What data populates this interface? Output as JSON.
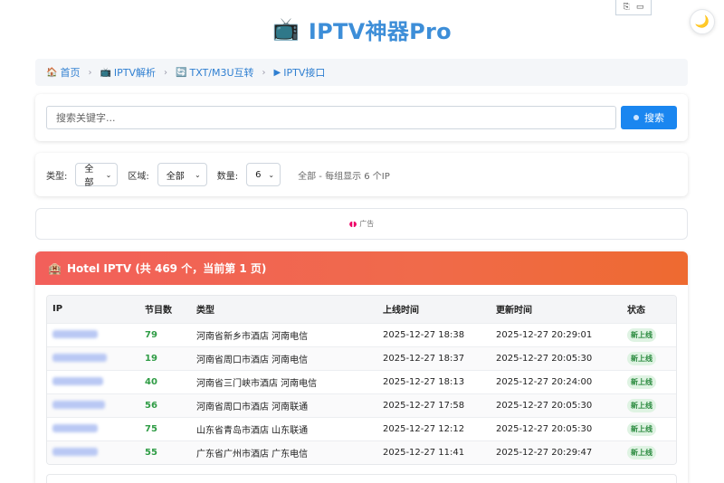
{
  "app": {
    "title": "IPTV神器Pro",
    "title_icon": "tv-icon",
    "brand_color": "#3d8ed8"
  },
  "top_icons": [
    "clipboard-icon",
    "monitor-icon"
  ],
  "theme_toggle": {
    "icon": "moon-icon",
    "glyph": "🌙"
  },
  "breadcrumb": [
    {
      "icon": "🏠",
      "icon_name": "home-icon",
      "label": "首页"
    },
    {
      "icon": "📺",
      "icon_name": "tv-icon",
      "label": "IPTV解析"
    },
    {
      "icon": "🔄",
      "icon_name": "convert-icon",
      "label": "TXT/M3U互转"
    },
    {
      "icon": "▶",
      "icon_name": "play-icon",
      "label": "IPTV接口"
    }
  ],
  "search": {
    "placeholder": "搜索关键字...",
    "button_label": "搜索",
    "button_color": "#1a86f0"
  },
  "filters": {
    "type_label": "类型:",
    "type_value": "全部",
    "region_label": "区域:",
    "region_value": "全部",
    "count_label": "数量:",
    "count_value": "6",
    "summary": "全部 - 每组显示 6 个IP"
  },
  "ad": {
    "label": "广告"
  },
  "results": {
    "header_icon": "🏨",
    "header": "Hotel IPTV (共 469 个，当前第 1 页)",
    "columns": [
      "IP",
      "节目数",
      "类型",
      "上线时间",
      "更新时间",
      "状态"
    ],
    "rows": [
      {
        "ip": "",
        "ip_width": 50,
        "count": "79",
        "type": "河南省新乡市酒店 河南电信",
        "online": "2025-12-27 18:38",
        "updated": "2025-12-27 20:29:01",
        "status": "新上线"
      },
      {
        "ip": "",
        "ip_width": 60,
        "count": "19",
        "type": "河南省周口市酒店 河南电信",
        "online": "2025-12-27 18:37",
        "updated": "2025-12-27 20:05:30",
        "status": "新上线"
      },
      {
        "ip": "",
        "ip_width": 56,
        "count": "40",
        "type": "河南省三门峡市酒店 河南电信",
        "online": "2025-12-27 18:13",
        "updated": "2025-12-27 20:24:00",
        "status": "新上线"
      },
      {
        "ip": "",
        "ip_width": 58,
        "count": "56",
        "type": "河南省周口市酒店 河南联通",
        "online": "2025-12-27 17:58",
        "updated": "2025-12-27 20:05:30",
        "status": "新上线"
      },
      {
        "ip": "",
        "ip_width": 50,
        "count": "75",
        "type": "山东省青岛市酒店 山东联通",
        "online": "2025-12-27 12:12",
        "updated": "2025-12-27 20:05:30",
        "status": "新上线"
      },
      {
        "ip": "",
        "ip_width": 50,
        "count": "55",
        "type": "广东省广州市酒店 广东电信",
        "online": "2025-12-27 11:41",
        "updated": "2025-12-27 20:29:47",
        "status": "新上线"
      }
    ],
    "count_color": "#2f9c45",
    "status_color": "#2a8a3e"
  }
}
